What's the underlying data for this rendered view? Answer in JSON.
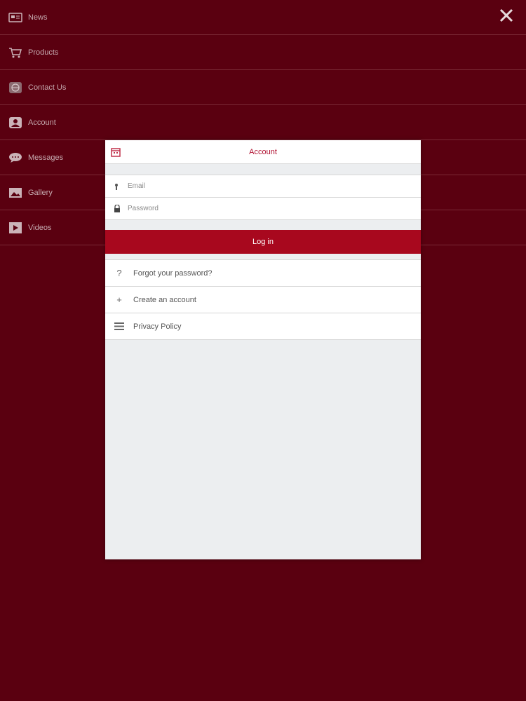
{
  "menu": {
    "items": [
      {
        "label": "News",
        "icon": "news-icon"
      },
      {
        "label": "Products",
        "icon": "cart-icon"
      },
      {
        "label": "Contact Us",
        "icon": "globe-icon"
      },
      {
        "label": "Account",
        "icon": "user-icon"
      },
      {
        "label": "Messages",
        "icon": "chat-icon"
      },
      {
        "label": "Gallery",
        "icon": "image-icon"
      },
      {
        "label": "Videos",
        "icon": "play-icon"
      }
    ]
  },
  "modal": {
    "title": "Account",
    "email_placeholder": "Email",
    "password_placeholder": "Password",
    "login_label": "Log in",
    "links": [
      {
        "label": "Forgot your password?",
        "icon": "question-icon"
      },
      {
        "label": "Create an account",
        "icon": "plus-icon"
      },
      {
        "label": "Privacy Policy",
        "icon": "list-icon"
      }
    ]
  },
  "colors": {
    "background": "#5a0010",
    "accent": "#a8081e",
    "title": "#b01030"
  }
}
